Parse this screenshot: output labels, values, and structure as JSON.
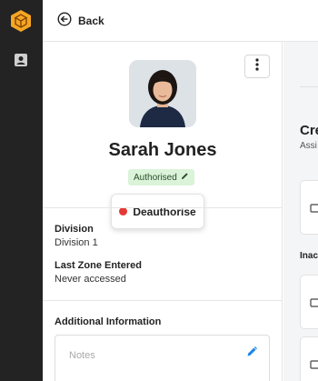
{
  "sidebar": {
    "logo": "cube-logo-icon",
    "items": [
      {
        "icon": "id-card-icon"
      }
    ]
  },
  "topbar": {
    "back_label": "Back",
    "back_icon": "arrow-left-circle-icon"
  },
  "profile": {
    "name": "Sarah Jones",
    "status": "Authorised",
    "status_icon": "pencil-icon",
    "deauth_label": "Deauthorise",
    "menu_icon": "more-vertical-icon",
    "photo": "person-photo"
  },
  "details": {
    "division_label": "Division",
    "division_value": "Division 1",
    "last_zone_label": "Last Zone Entered",
    "last_zone_value": "Never accessed"
  },
  "additional": {
    "title": "Additional Information",
    "notes_placeholder": "Notes",
    "edit_icon": "pencil-icon"
  },
  "right_panel": {
    "title": "Cre",
    "subtitle": "Assi",
    "inactive_label": "Inac"
  },
  "colors": {
    "sidebar_bg": "#232323",
    "logo_orange": "#f5a623",
    "badge_green": "#daf3d9",
    "dot_red": "#e53935",
    "edit_blue": "#1e88e5"
  }
}
